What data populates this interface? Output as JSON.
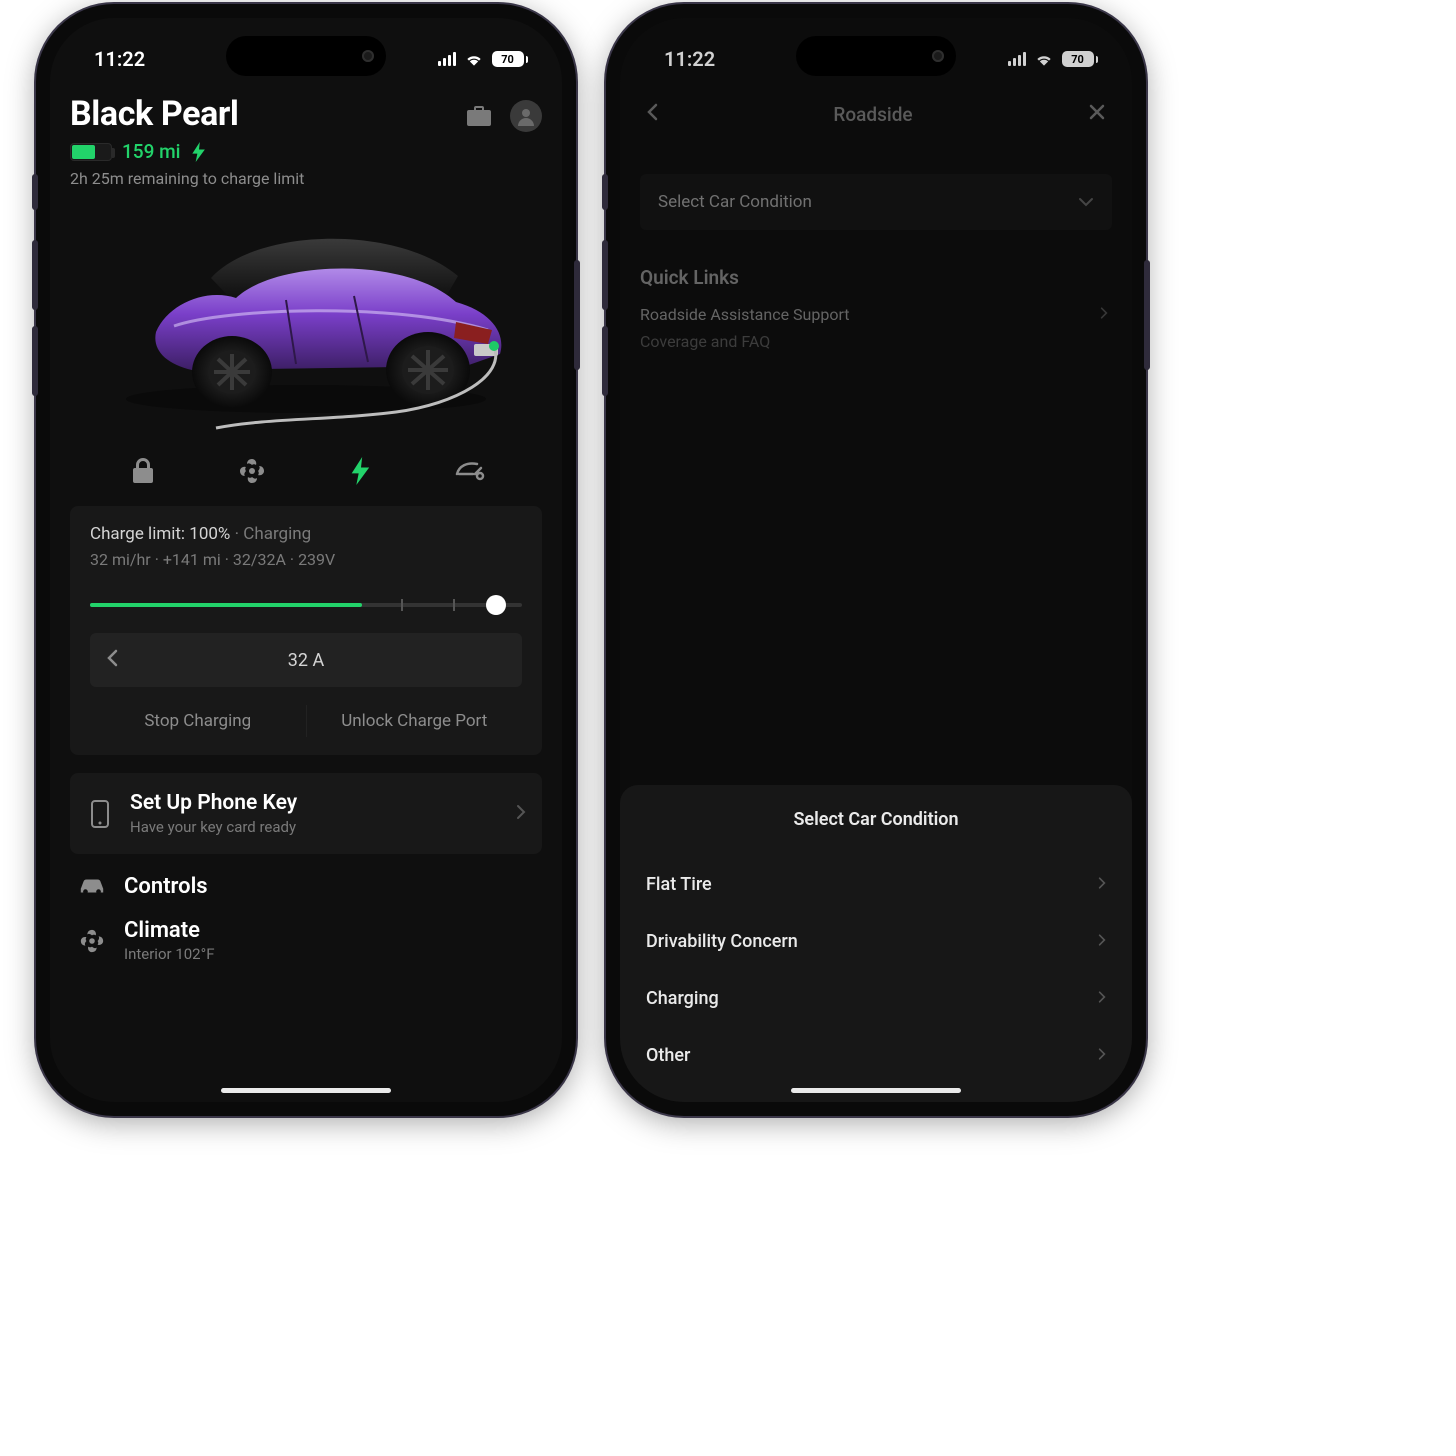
{
  "status": {
    "time": "11:22",
    "battery_pct": "70"
  },
  "left": {
    "car_name": "Black Pearl",
    "range": "159 mi",
    "remaining": "2h 25m remaining to charge limit",
    "charge": {
      "limit_label": "Charge limit: 100%",
      "state": "Charging",
      "rate": "32 mi/hr",
      "added": "+141 mi",
      "amps": "32/32A",
      "volts": "239V",
      "amp_selector": "32 A",
      "stop_label": "Stop Charging",
      "unlock_label": "Unlock Charge Port",
      "slider_fill_pct": 63,
      "thumb_pct": 94
    },
    "phonekey": {
      "title": "Set Up Phone Key",
      "sub": "Have your key card ready"
    },
    "menu": {
      "controls": "Controls",
      "climate": "Climate",
      "climate_sub": "Interior 102°F"
    }
  },
  "right": {
    "title": "Roadside",
    "select_placeholder": "Select Car Condition",
    "quick_links_title": "Quick Links",
    "quick_links": {
      "support": "Roadside Assistance Support",
      "faq": "Coverage and FAQ"
    },
    "sheet": {
      "title": "Select Car Condition",
      "options": {
        "flat": "Flat Tire",
        "drive": "Drivability Concern",
        "charge": "Charging",
        "other": "Other"
      }
    }
  }
}
